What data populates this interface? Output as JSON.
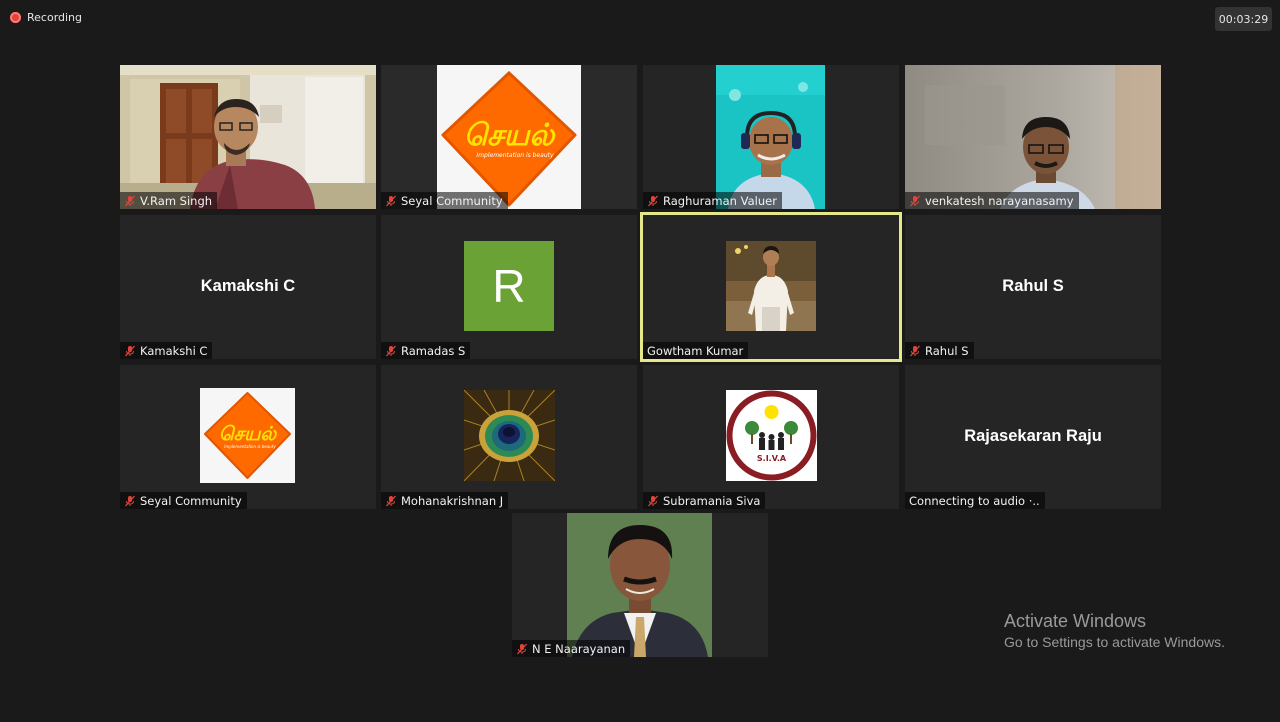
{
  "recording": {
    "label": "Recording"
  },
  "timer": {
    "value": "00:03:29"
  },
  "participants": [
    {
      "name": "V.Ram Singh",
      "muted": true
    },
    {
      "name": "Seyal Community",
      "muted": true
    },
    {
      "name": "Raghuraman Valuer",
      "muted": true
    },
    {
      "name": "venkatesh narayanasamy",
      "muted": true
    },
    {
      "name": "Kamakshi C",
      "display": "Kamakshi C",
      "muted": true
    },
    {
      "name": "Ramadas S",
      "avatar_letter": "R",
      "muted": true
    },
    {
      "name": "Gowtham Kumar",
      "muted": false,
      "active_speaker": true
    },
    {
      "name": "Rahul S",
      "display": "Rahul S",
      "muted": true
    },
    {
      "name": "Seyal Community",
      "muted": true
    },
    {
      "name": "Mohanakrishnan J",
      "muted": true
    },
    {
      "name": "Subramania Siva",
      "muted": true
    },
    {
      "name": "Connecting to audio ·..",
      "display": "Rajasekaran Raju"
    },
    {
      "name": "N E Naarayanan",
      "muted": true
    }
  ],
  "seyal_logo": {
    "text": "செயல்",
    "tagline": "Implementation is beauty"
  },
  "siva_logo": {
    "text": "S.I.V.A"
  },
  "colors": {
    "active_border": "#e4e88a",
    "muted_icon": "#e0443a",
    "avatar_green": "#6aa235",
    "seyal_orange": "#ff6a00"
  },
  "watermark": {
    "line1": "Activate Windows",
    "line2": "Go to Settings to activate Windows."
  }
}
